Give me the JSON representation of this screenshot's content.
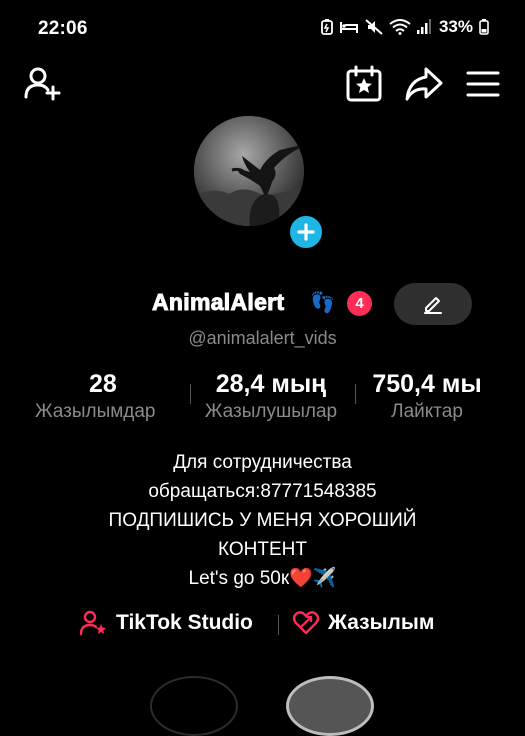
{
  "status_bar": {
    "time": "22:06",
    "battery": "33%"
  },
  "profile": {
    "username": "AnimalAlert",
    "emoji": "👣",
    "notification_count": "4",
    "handle": "@animalalert_vids"
  },
  "stats": [
    {
      "value": "28",
      "label": "Жазылымдар"
    },
    {
      "value": "28,4 мың",
      "label": "Жазылушылар"
    },
    {
      "value": "750,4 мы",
      "label": "Лайктар"
    }
  ],
  "bio": {
    "lines": [
      "Для сотрудничества",
      "обращаться:87771548385",
      "ПОДПИШИСЬ У МЕНЯ ХОРОШИЙ",
      "КОНТЕНТ",
      "Let's go 50к❤️✈️"
    ]
  },
  "links": {
    "studio": "TikTok Studio",
    "subscriptions": "Жазылым"
  },
  "colors": {
    "accent_blue": "#1fb6e6",
    "badge_red": "#ff2d55",
    "link_red": "#fe2c55",
    "muted_text": "#8a8a8a"
  }
}
